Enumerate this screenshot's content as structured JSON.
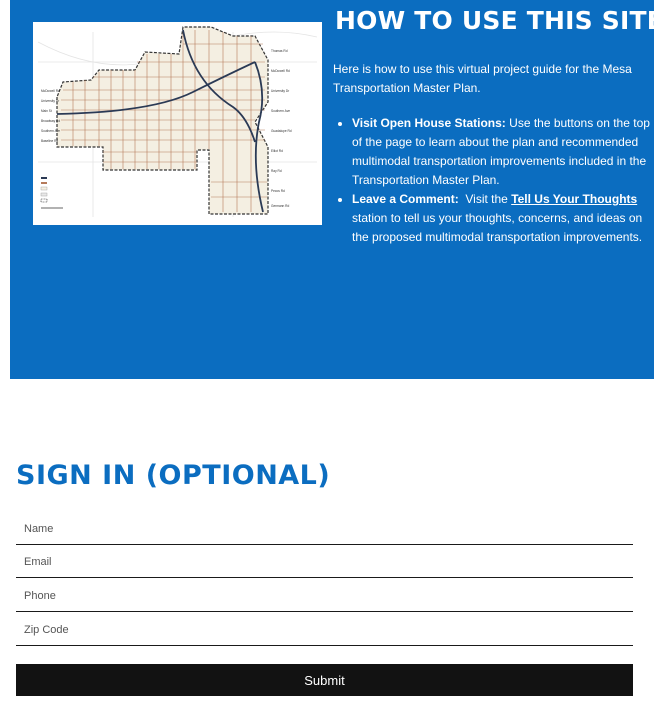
{
  "hero": {
    "title": "HOW TO USE THIS SITE",
    "intro": "Here is how to use this virtual project guide for the Mesa Transportation Master Plan.",
    "items": [
      {
        "bold": "Visit Open House Stations:",
        "text": " Use the buttons on the top of the page to learn about the plan and recommended multimodal transportation improvements included in the Transportation Master Plan."
      },
      {
        "bold": "Leave a Comment:",
        "pre": "  Visit the ",
        "link": "Tell Us Your Thoughts",
        "post": " station to tell us your thoughts, concerns, and ideas on the proposed multimodal transportation improvements."
      }
    ],
    "colors": {
      "background": "#0b6dc0",
      "text": "#ffffff"
    }
  },
  "map": {
    "icon": "city-street-map-image"
  },
  "signin": {
    "title": "SIGN IN (OPTIONAL)",
    "fields": [
      {
        "placeholder": "Name",
        "value": ""
      },
      {
        "placeholder": "Email",
        "value": ""
      },
      {
        "placeholder": "Phone",
        "value": ""
      },
      {
        "placeholder": "Zip Code",
        "value": ""
      }
    ],
    "submit_label": "Submit",
    "colors": {
      "title": "#0b6dc0",
      "button": "#121212"
    }
  }
}
